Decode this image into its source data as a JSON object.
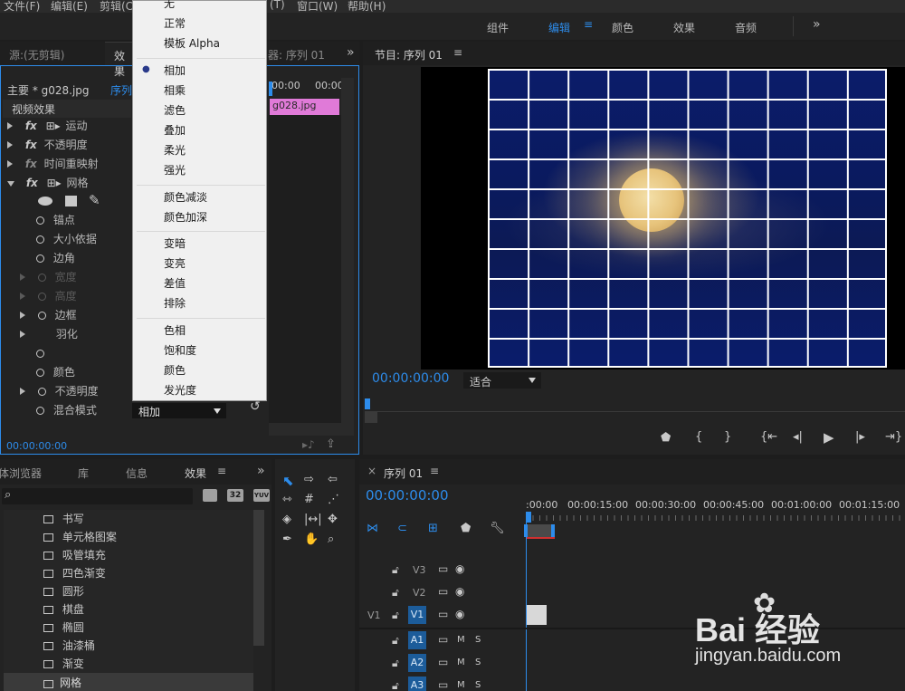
{
  "menubar": {
    "items": [
      "文件(F)",
      "编辑(E)",
      "剪辑(C",
      "(T)",
      "窗口(W)",
      "帮助(H)"
    ]
  },
  "workspaces": {
    "items": [
      "组件",
      "编辑",
      "颜色",
      "效果",
      "音频"
    ],
    "active": "编辑",
    "more": "»"
  },
  "effect_controls": {
    "tabs": [
      "源:(无剪辑)",
      "效果",
      "器: 序列 01"
    ],
    "more": "»",
    "master_clip": "主要 * g028.jpg",
    "sequence_link": "序列",
    "section": "视频效果",
    "time_ruler": [
      "00:00",
      "00:00"
    ],
    "clip_name": "g028.jpg",
    "rows": [
      {
        "label": "运动"
      },
      {
        "label": "不透明度"
      },
      {
        "label": "时间重映射"
      },
      {
        "label": "网格"
      },
      {
        "label": "锚点"
      },
      {
        "label": "大小依据"
      },
      {
        "label": "边角"
      },
      {
        "label": "宽度"
      },
      {
        "label": "高度"
      },
      {
        "label": "边框"
      },
      {
        "label": "羽化"
      },
      {
        "label": ""
      },
      {
        "label": "颜色"
      },
      {
        "label": "不透明度"
      },
      {
        "label": "混合模式"
      }
    ],
    "blend_value": "相加",
    "timecode": "00:00:00:00"
  },
  "blend_menu": {
    "groups": [
      [
        "无",
        "正常",
        "模板 Alpha"
      ],
      [
        "相加",
        "相乘",
        "滤色",
        "叠加",
        "柔光",
        "强光"
      ],
      [
        "颜色减淡",
        "颜色加深"
      ],
      [
        "变暗",
        "变亮",
        "差值",
        "排除"
      ],
      [
        "色相",
        "饱和度",
        "颜色",
        "发光度"
      ]
    ],
    "selected": "相加"
  },
  "program_monitor": {
    "title": "节目: 序列 01",
    "timecode": "00:00:00:00",
    "fit": "适合"
  },
  "effects_browser": {
    "tabs": [
      "体浏览器",
      "库",
      "信息",
      "效果"
    ],
    "more": "»",
    "items": [
      "书写",
      "单元格图案",
      "吸管填充",
      "四色渐变",
      "圆形",
      "棋盘",
      "椭圆",
      "油漆桶",
      "渐变",
      "网格"
    ],
    "selected": "网格",
    "filter_badges": [
      "32",
      "YUV"
    ]
  },
  "timeline": {
    "title": "序列 01",
    "timecode": "00:00:00:00",
    "ruler": [
      ":00:00",
      "00:00:15:00",
      "00:00:30:00",
      "00:00:45:00",
      "00:01:00:00",
      "00:01:15:00"
    ],
    "video_tracks": [
      "V3",
      "V2",
      "V1"
    ],
    "source_v": "V1",
    "audio_tracks": [
      "A1",
      "A2",
      "A3"
    ],
    "audio_m": "M",
    "audio_s": "S"
  },
  "watermark": {
    "logo": "Bai 经验",
    "url": "jingyan.baidu.com"
  },
  "colors": {
    "accent_blue": "#2d8ceb",
    "clip_pink": "#e07ad8",
    "menu_bg": "#f0f0f0"
  }
}
